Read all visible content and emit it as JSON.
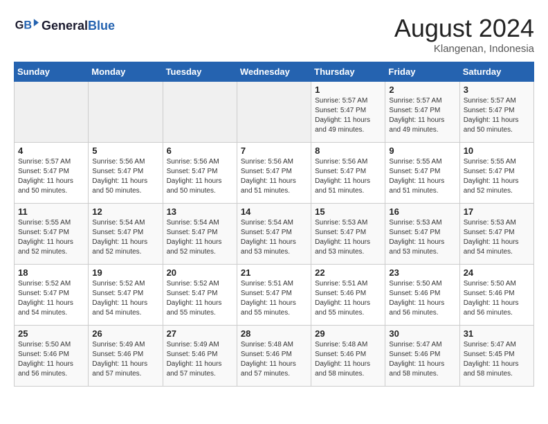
{
  "header": {
    "logo_line1": "General",
    "logo_line2": "Blue",
    "title": "August 2024",
    "subtitle": "Klangenan, Indonesia"
  },
  "days_of_week": [
    "Sunday",
    "Monday",
    "Tuesday",
    "Wednesday",
    "Thursday",
    "Friday",
    "Saturday"
  ],
  "weeks": [
    [
      {
        "day": "",
        "info": ""
      },
      {
        "day": "",
        "info": ""
      },
      {
        "day": "",
        "info": ""
      },
      {
        "day": "",
        "info": ""
      },
      {
        "day": "1",
        "info": "Sunrise: 5:57 AM\nSunset: 5:47 PM\nDaylight: 11 hours\nand 49 minutes."
      },
      {
        "day": "2",
        "info": "Sunrise: 5:57 AM\nSunset: 5:47 PM\nDaylight: 11 hours\nand 49 minutes."
      },
      {
        "day": "3",
        "info": "Sunrise: 5:57 AM\nSunset: 5:47 PM\nDaylight: 11 hours\nand 50 minutes."
      }
    ],
    [
      {
        "day": "4",
        "info": "Sunrise: 5:57 AM\nSunset: 5:47 PM\nDaylight: 11 hours\nand 50 minutes."
      },
      {
        "day": "5",
        "info": "Sunrise: 5:56 AM\nSunset: 5:47 PM\nDaylight: 11 hours\nand 50 minutes."
      },
      {
        "day": "6",
        "info": "Sunrise: 5:56 AM\nSunset: 5:47 PM\nDaylight: 11 hours\nand 50 minutes."
      },
      {
        "day": "7",
        "info": "Sunrise: 5:56 AM\nSunset: 5:47 PM\nDaylight: 11 hours\nand 51 minutes."
      },
      {
        "day": "8",
        "info": "Sunrise: 5:56 AM\nSunset: 5:47 PM\nDaylight: 11 hours\nand 51 minutes."
      },
      {
        "day": "9",
        "info": "Sunrise: 5:55 AM\nSunset: 5:47 PM\nDaylight: 11 hours\nand 51 minutes."
      },
      {
        "day": "10",
        "info": "Sunrise: 5:55 AM\nSunset: 5:47 PM\nDaylight: 11 hours\nand 52 minutes."
      }
    ],
    [
      {
        "day": "11",
        "info": "Sunrise: 5:55 AM\nSunset: 5:47 PM\nDaylight: 11 hours\nand 52 minutes."
      },
      {
        "day": "12",
        "info": "Sunrise: 5:54 AM\nSunset: 5:47 PM\nDaylight: 11 hours\nand 52 minutes."
      },
      {
        "day": "13",
        "info": "Sunrise: 5:54 AM\nSunset: 5:47 PM\nDaylight: 11 hours\nand 52 minutes."
      },
      {
        "day": "14",
        "info": "Sunrise: 5:54 AM\nSunset: 5:47 PM\nDaylight: 11 hours\nand 53 minutes."
      },
      {
        "day": "15",
        "info": "Sunrise: 5:53 AM\nSunset: 5:47 PM\nDaylight: 11 hours\nand 53 minutes."
      },
      {
        "day": "16",
        "info": "Sunrise: 5:53 AM\nSunset: 5:47 PM\nDaylight: 11 hours\nand 53 minutes."
      },
      {
        "day": "17",
        "info": "Sunrise: 5:53 AM\nSunset: 5:47 PM\nDaylight: 11 hours\nand 54 minutes."
      }
    ],
    [
      {
        "day": "18",
        "info": "Sunrise: 5:52 AM\nSunset: 5:47 PM\nDaylight: 11 hours\nand 54 minutes."
      },
      {
        "day": "19",
        "info": "Sunrise: 5:52 AM\nSunset: 5:47 PM\nDaylight: 11 hours\nand 54 minutes."
      },
      {
        "day": "20",
        "info": "Sunrise: 5:52 AM\nSunset: 5:47 PM\nDaylight: 11 hours\nand 55 minutes."
      },
      {
        "day": "21",
        "info": "Sunrise: 5:51 AM\nSunset: 5:47 PM\nDaylight: 11 hours\nand 55 minutes."
      },
      {
        "day": "22",
        "info": "Sunrise: 5:51 AM\nSunset: 5:46 PM\nDaylight: 11 hours\nand 55 minutes."
      },
      {
        "day": "23",
        "info": "Sunrise: 5:50 AM\nSunset: 5:46 PM\nDaylight: 11 hours\nand 56 minutes."
      },
      {
        "day": "24",
        "info": "Sunrise: 5:50 AM\nSunset: 5:46 PM\nDaylight: 11 hours\nand 56 minutes."
      }
    ],
    [
      {
        "day": "25",
        "info": "Sunrise: 5:50 AM\nSunset: 5:46 PM\nDaylight: 11 hours\nand 56 minutes."
      },
      {
        "day": "26",
        "info": "Sunrise: 5:49 AM\nSunset: 5:46 PM\nDaylight: 11 hours\nand 57 minutes."
      },
      {
        "day": "27",
        "info": "Sunrise: 5:49 AM\nSunset: 5:46 PM\nDaylight: 11 hours\nand 57 minutes."
      },
      {
        "day": "28",
        "info": "Sunrise: 5:48 AM\nSunset: 5:46 PM\nDaylight: 11 hours\nand 57 minutes."
      },
      {
        "day": "29",
        "info": "Sunrise: 5:48 AM\nSunset: 5:46 PM\nDaylight: 11 hours\nand 58 minutes."
      },
      {
        "day": "30",
        "info": "Sunrise: 5:47 AM\nSunset: 5:46 PM\nDaylight: 11 hours\nand 58 minutes."
      },
      {
        "day": "31",
        "info": "Sunrise: 5:47 AM\nSunset: 5:45 PM\nDaylight: 11 hours\nand 58 minutes."
      }
    ]
  ]
}
